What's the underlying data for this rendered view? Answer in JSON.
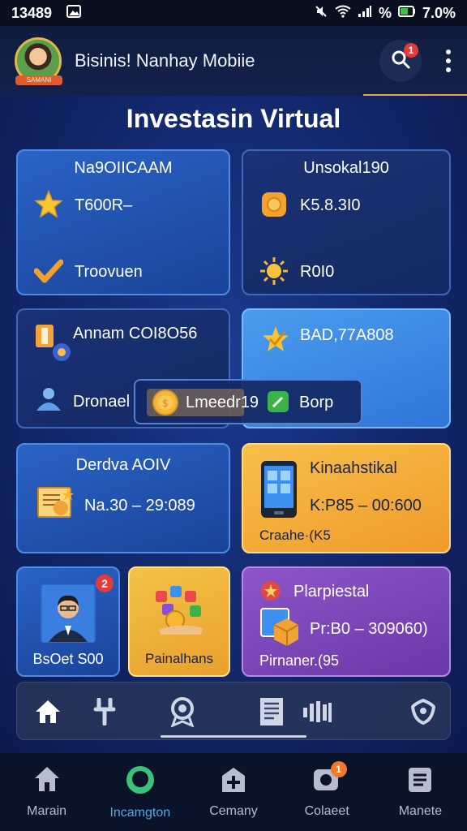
{
  "status_bar": {
    "time": "13489",
    "battery": "7.0%",
    "signal_text": "%"
  },
  "app_bar": {
    "avatar_ribbon": "SAMANI",
    "title": "Bisinis! Nanhay Mobiie",
    "search_badge": "1"
  },
  "page": {
    "title": "Investasin Virtual"
  },
  "cards": {
    "c1": {
      "header": "Na9OIICAAM",
      "row1": "T600R–",
      "row2": "Troovuen"
    },
    "c2": {
      "header": "Unsokal190",
      "row1": "K5.8.3I0",
      "row2": "R0I0"
    },
    "c3": {
      "row1": "Annam COI8O56",
      "row2": "Dronael"
    },
    "c4": {
      "row1": "BAD,77A808"
    },
    "overlay": {
      "left_label": "Lmeedr19",
      "right_label": "Borp"
    },
    "c5": {
      "header": "Derdva AOIV",
      "row1": "Na.30 – 29:089"
    },
    "c6": {
      "header": "Kinaahstikal",
      "row1": "K:P85 – 00:600",
      "row2": "Craahe·(K5"
    },
    "c7": {
      "label": "BsOet S00",
      "badge": "2"
    },
    "c8": {
      "label": "Painalhans"
    },
    "c9": {
      "header": "Plarpiestal",
      "row1": "Pr:B0 – 309060)",
      "row2": "Pirnaner.(95"
    }
  },
  "icon_strip": {
    "items": [
      "home-icon",
      "tools-icon",
      "award-icon",
      "document-icon",
      "audio-bars-icon",
      "shield-icon"
    ]
  },
  "bottom_nav": {
    "items": [
      {
        "label": "Marain",
        "icon": "house-icon"
      },
      {
        "label": "Incamgton",
        "icon": "chat-icon"
      },
      {
        "label": "Cemany",
        "icon": "building-icon"
      },
      {
        "label": "Colaeet",
        "icon": "notification-icon",
        "badge": "1"
      },
      {
        "label": "Manete",
        "icon": "clipboard-icon"
      }
    ]
  },
  "colors": {
    "accent": "#f0a339",
    "active_nav": "#4fa9e8",
    "badge": "#e23b3b"
  }
}
